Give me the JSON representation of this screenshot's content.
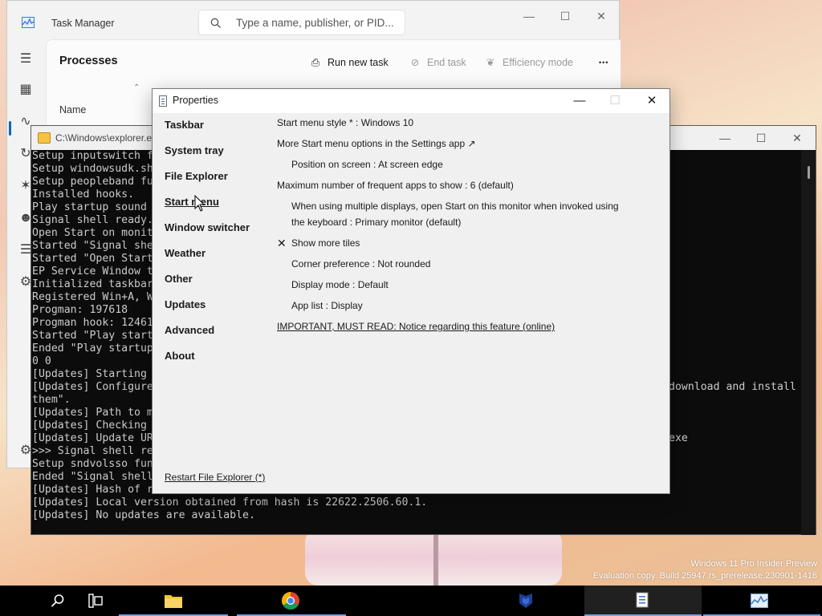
{
  "task_manager": {
    "title": "Task Manager",
    "search_placeholder": "Type a name, publisher, or PID...",
    "heading": "Processes",
    "toolbar": {
      "run_new_task": "Run new task",
      "end_task": "End task",
      "efficiency_mode": "Efficiency mode",
      "more": "•••"
    },
    "column_name": "Name",
    "nav_icons": [
      "hamburger-icon",
      "processes-icon",
      "performance-icon",
      "app-history-icon",
      "startup-apps-icon",
      "users-icon",
      "details-icon",
      "services-icon",
      "settings-icon"
    ]
  },
  "console": {
    "title": "C:\\Windows\\explorer.e",
    "lines": [
      "Setup inputswitch f",
      "Setup windowsudk.sh",
      "Setup peopleband fu",
      "Installed hooks.",
      "Play startup sound",
      "Signal shell ready.",
      "Open Start on monit",
      "Started \"Signal she",
      "Started \"Open Start",
      "EP Service Window t",
      "Initialized taskbar",
      "Registered Win+A, W",
      "Progman: 197618",
      "Progman hook: 12461",
      "Started \"Play start",
      "Ended \"Play startup",
      "0 0",
      "[Updates] Starting",
      "[Updates] Configure",
      "them\".",
      "[Updates] Path to m",
      "[Updates] Checking",
      "[Updates] Update UR",
      ">>> Signal shell re",
      "Setup sndvolsso fun",
      "Ended \"Signal shell",
      "[Updates] Hash of r",
      "[Updates] Local version obtained from hash is 22622.2506.60.1.",
      "[Updates] No updates are available."
    ],
    "right_fragments": {
      "download_install": "download and install",
      "exe": "exe"
    }
  },
  "properties": {
    "title": "Properties",
    "nav": [
      {
        "label": "Taskbar",
        "selected": false
      },
      {
        "label": "System tray",
        "selected": false
      },
      {
        "label": "File Explorer",
        "selected": false
      },
      {
        "label": "Start menu",
        "selected": true
      },
      {
        "label": "Window switcher",
        "selected": false
      },
      {
        "label": "Weather",
        "selected": false
      },
      {
        "label": "Other",
        "selected": false
      },
      {
        "label": "Updates",
        "selected": false
      },
      {
        "label": "Advanced",
        "selected": false
      },
      {
        "label": "About",
        "selected": false
      }
    ],
    "settings": {
      "start_menu_style": "Start menu style * : Windows 10",
      "more_options": "More Start menu options in the Settings app ↗",
      "position": "Position on screen : At screen edge",
      "max_frequent": "Maximum number of frequent apps to show : 6 (default)",
      "multi_display_line1": "When using multiple displays, open Start on this monitor when invoked using",
      "multi_display_line2": "the keyboard : Primary monitor (default)",
      "show_more_tiles": "Show more tiles",
      "show_more_tiles_checked": true,
      "check_glyph": "✕",
      "corner_pref": "Corner preference : Not rounded",
      "display_mode": "Display mode : Default",
      "app_list": "App list : Display",
      "important_link": "IMPORTANT, MUST READ: Notice regarding this feature (online)"
    },
    "restart_link": "Restart File Explorer (*)"
  },
  "desktop": {
    "watermark_line1": "Windows 11 Pro Insider Preview",
    "watermark_line2": "Evaluation copy. Build 25947.rs_prerelease.230901-1416"
  },
  "taskbar": {
    "items": [
      "search-icon",
      "task-view-icon",
      "file-explorer-icon",
      "chrome-icon",
      "ep-setup-icon",
      "properties-app-icon",
      "task-manager-icon"
    ]
  },
  "colors": {
    "accent": "#0067c0",
    "console_bg": "#0c0c0c",
    "console_fg": "#cccccc",
    "taskbar_bg": "#000000"
  }
}
